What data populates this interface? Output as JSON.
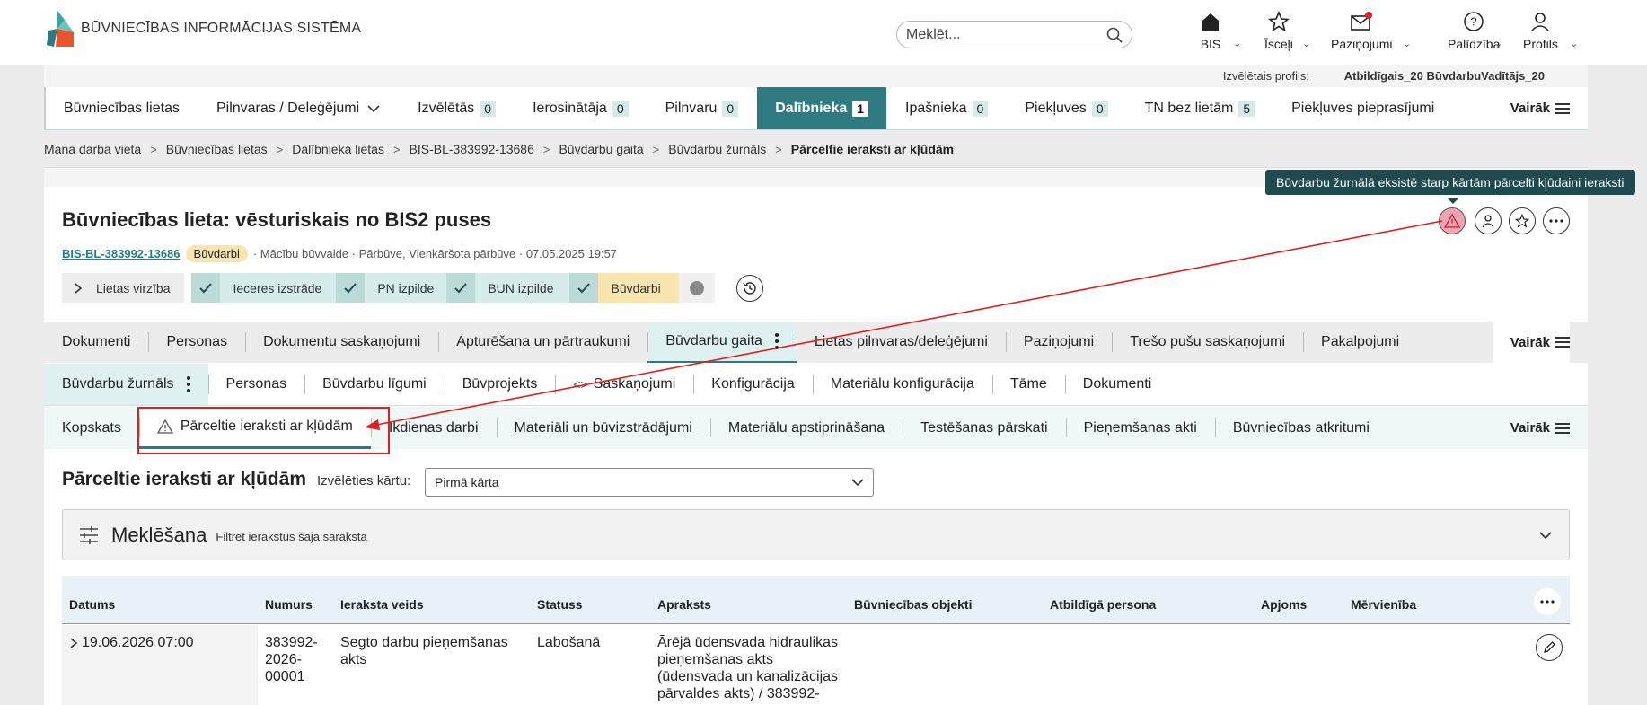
{
  "header": {
    "logo_text": "BŪVNIECĪBAS INFORMĀCIJAS SISTĒMA",
    "search_placeholder": "Meklēt...",
    "nav": [
      {
        "label": "BIS",
        "icon": "home-icon"
      },
      {
        "label": "Īsceļi",
        "icon": "star-icon"
      },
      {
        "label": "Paziņojumi",
        "icon": "mail-icon"
      },
      {
        "label": "Palīdzība",
        "icon": "help-icon"
      },
      {
        "label": "Profils",
        "icon": "user-icon"
      }
    ]
  },
  "profile": {
    "label": "Izvēlētais profils:",
    "value": "Atbildīgais_20 BūvdarbuVadītājs_20"
  },
  "main_tabs": [
    {
      "label": "Būvniecības lietas",
      "badge": ""
    },
    {
      "label": "Pilnvaras / Deleģējumi",
      "badge": ""
    },
    {
      "label": "Izvēlētās",
      "badge": "0"
    },
    {
      "label": "Ierosinātāja",
      "badge": "0"
    },
    {
      "label": "Pilnvaru",
      "badge": "0"
    },
    {
      "label": "Dalībnieka",
      "badge": "1"
    },
    {
      "label": "Īpašnieka",
      "badge": "0"
    },
    {
      "label": "Piekļuves",
      "badge": "0"
    },
    {
      "label": "TN bez lietām",
      "badge": "5"
    },
    {
      "label": "Piekļuves pieprasījumi",
      "badge": ""
    }
  ],
  "more_label": "Vairāk",
  "breadcrumb": [
    "Mana darba vieta",
    "Būvniecības lietas",
    "Dalībnieka lietas",
    "BIS-BL-383992-13686",
    "Būvdarbu gaita",
    "Būvdarbu žurnāls",
    "Pārceltie ieraksti ar kļūdām"
  ],
  "case": {
    "title": "Būvniecības lieta: vēsturiskais no BIS2 puses",
    "id": "BIS-BL-383992-13686",
    "stage": "Būvdarbi",
    "meta": "· Mācību būvvalde · Pārbūve, Vienkāršota pārbūve · 07.05.2025 19:57"
  },
  "progress": {
    "toggle_label": "Lietas virzība",
    "done_steps": [
      "Ieceres izstrāde",
      "PN izpilde",
      "BUN izpilde"
    ],
    "current_step": "Būvdarbi"
  },
  "tooltip": "Būvdarbu žurnālā eksistē starp kārtām pārcelti kļūdaini ieraksti",
  "tabs_level2": [
    "Dokumenti",
    "Personas",
    "Dokumentu saskaņojumi",
    "Apturēšana un pārtraukumi",
    "Būvdarbu gaita",
    "Lietas pilnvaras/deleģējumi",
    "Paziņojumi",
    "Trešo pušu saskaņojumi",
    "Pakalpojumi"
  ],
  "tabs_level3": [
    "Būvdarbu žurnāls",
    "Personas",
    "Būvdarbu līgumi",
    "Būvprojekts",
    "Saskaņojumi",
    "Konfigurācija",
    "Materiālu konfigurācija",
    "Tāme",
    "Dokumenti"
  ],
  "tabs_level4": [
    "Kopskats",
    "Pārceltie ieraksti ar kļūdām",
    "Ikdienas darbi",
    "Materiāli un būvizstrādājumi",
    "Materiālu apstiprināšana",
    "Testēšanas pārskati",
    "Pieņemšanas akti",
    "Būvniecības atkritumi"
  ],
  "section": {
    "title": "Pārceltie ieraksti ar kļūdām",
    "select_label": "Izvēlēties kārtu:",
    "select_value": "Pirmā kārta"
  },
  "search_panel": {
    "title": "Meklēšana",
    "subtitle": "Filtrēt ierakstus šajā sarakstā"
  },
  "table": {
    "columns": [
      "Datums",
      "Numurs",
      "Ieraksta veids",
      "Statuss",
      "Apraksts",
      "Būvniecības objekti",
      "Atbildīgā persona",
      "Apjoms",
      "Mērvienība"
    ],
    "rows": [
      {
        "date": "19.06.2026 07:00",
        "number": [
          "383992-",
          "2026-",
          "00001"
        ],
        "type": [
          "Segto darbu pieņemšanas",
          "akts"
        ],
        "status": "Labošanā",
        "description": [
          "Ārējā ūdensvada hidraulikas",
          "pieņemšanas akts",
          "(ūdensvada un kanalizācijas",
          "pārvaldes akts) / 383992-"
        ]
      }
    ]
  },
  "colors": {
    "accent": "#2d7a80",
    "annotation": "#dd2020",
    "warning_bg": "#f2a3b4"
  }
}
